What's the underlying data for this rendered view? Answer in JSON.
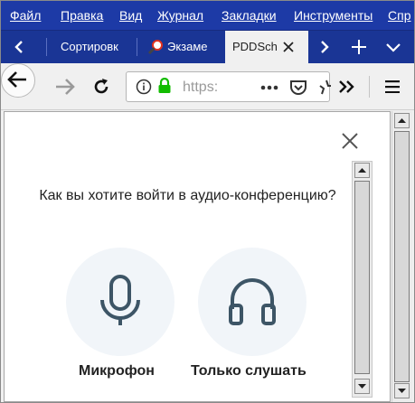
{
  "menu": [
    "Файл",
    "Правка",
    "Вид",
    "Журнал",
    "Закладки",
    "Инструменты",
    "Спр"
  ],
  "tabs": [
    {
      "label": "Сортировк"
    },
    {
      "label": "Экзаме"
    },
    {
      "label": "PDDSch"
    }
  ],
  "url": {
    "text": "https:"
  },
  "dialog": {
    "question": "Как вы хотите войти в аудио-конференцию?",
    "options": [
      {
        "label": "Микрофон",
        "icon": "microphone-icon"
      },
      {
        "label": "Только слушать",
        "icon": "headphones-icon"
      }
    ]
  },
  "colors": {
    "menu_bg": "#1d3aa6",
    "icon": "#3d5566",
    "option_bg": "#f1f5f9"
  }
}
